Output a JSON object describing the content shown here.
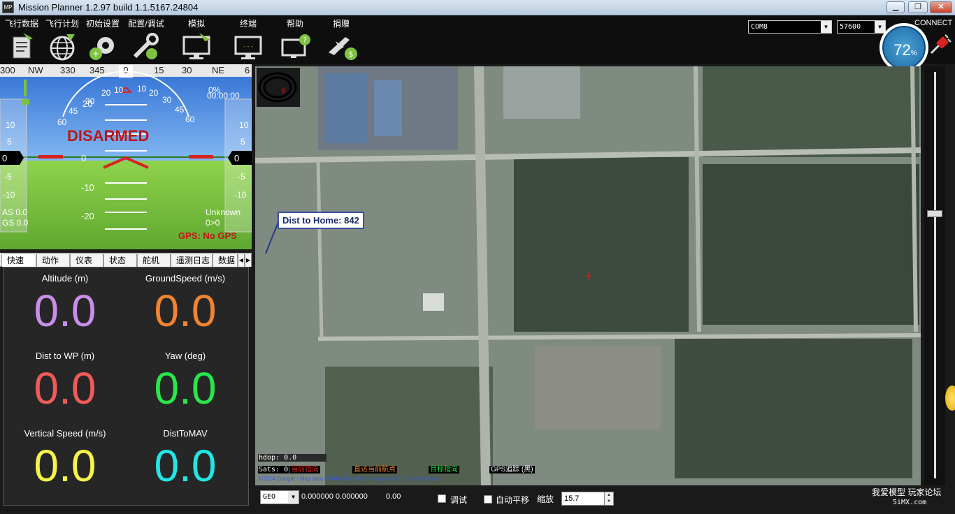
{
  "window": {
    "title": "Mission Planner 1.2.97 build 1.1.5167.24804",
    "icon_text": "MP"
  },
  "menu": [
    {
      "label": "飞行数据",
      "icon": "flight-data-icon"
    },
    {
      "label": "飞行计划",
      "icon": "flight-plan-icon"
    },
    {
      "label": "初始设置",
      "icon": "initial-setup-icon"
    },
    {
      "label": "配置/调试",
      "icon": "config-tuning-icon"
    },
    {
      "label": "模拟",
      "icon": "simulation-icon"
    },
    {
      "label": "终端",
      "icon": "terminal-icon"
    },
    {
      "label": "帮助",
      "icon": "help-icon"
    },
    {
      "label": "捐赠",
      "icon": "donate-icon"
    }
  ],
  "connection": {
    "port": "COM8",
    "baud": "57600",
    "connect_label": "CONNECT"
  },
  "battery_gauge": {
    "value": "72",
    "unit": "%"
  },
  "hud": {
    "compass_labels": [
      "300",
      "NW",
      "330",
      "345",
      "0",
      "15",
      "30",
      "NE",
      "6"
    ],
    "heading_box": "0",
    "status": "DISARMED",
    "pitch_labels": [
      "20",
      "10",
      "0",
      "-10",
      "-20"
    ],
    "roll_labels": [
      "30",
      "20",
      "10",
      "0",
      "10",
      "20",
      "30",
      "45",
      "60",
      "45",
      "60"
    ],
    "speed_scale": [
      "10",
      "5",
      "0",
      "-5",
      "-10"
    ],
    "alt_scale": [
      "10",
      "5",
      "0",
      "-5",
      "-10"
    ],
    "airspeed": "AS 0.0",
    "groundspeed": "GS 0.0",
    "flight_mode": "Unknown",
    "wp_dist": "0>0",
    "timer": "00:00:00",
    "battery_pct": "0%",
    "gps_status": "GPS: No GPS"
  },
  "tabs": [
    "快速",
    "动作",
    "仪表",
    "状态",
    "舵机",
    "遥测日志",
    "数据"
  ],
  "quick": [
    {
      "label": "Altitude (m)",
      "value": "0.0",
      "color": "#c88ee8"
    },
    {
      "label": "GroundSpeed (m/s)",
      "value": "0.0",
      "color": "#f08432"
    },
    {
      "label": "Dist to WP (m)",
      "value": "0.0",
      "color": "#f05a5a"
    },
    {
      "label": "Yaw (deg)",
      "value": "0.0",
      "color": "#26e84a"
    },
    {
      "label": "Vertical Speed (m/s)",
      "value": "0.0",
      "color": "#f4f44a"
    },
    {
      "label": "DistToMAV",
      "value": "0.0",
      "color": "#22e6e6"
    }
  ],
  "map": {
    "dist_to_home": "Dist to Home: 842",
    "hdop": "hdop: 0.0",
    "sats": "Sats: 0",
    "btn_fly_here": "当前指向",
    "btn_fly_to_wp": "直达当前航点",
    "btn_target": "目标指向",
    "btn_gps_track": "GPS追踪 (黑)",
    "copyright": "©2014 Google - Map data ©2014 Tele Atlas, Imagery ©2014 TerraMetrics",
    "mini_compass_value": "0"
  },
  "bottom": {
    "coord_system": "GEO",
    "coords": "0.000000 0.000000",
    "alt": "0.00",
    "debug_label": "调试",
    "autopan_label": "自动平移",
    "zoom_label": "缩放",
    "zoom_value": "15.7",
    "brand_line1": "我爱模型 玩家论坛",
    "brand_line2": "5iMX.com"
  }
}
